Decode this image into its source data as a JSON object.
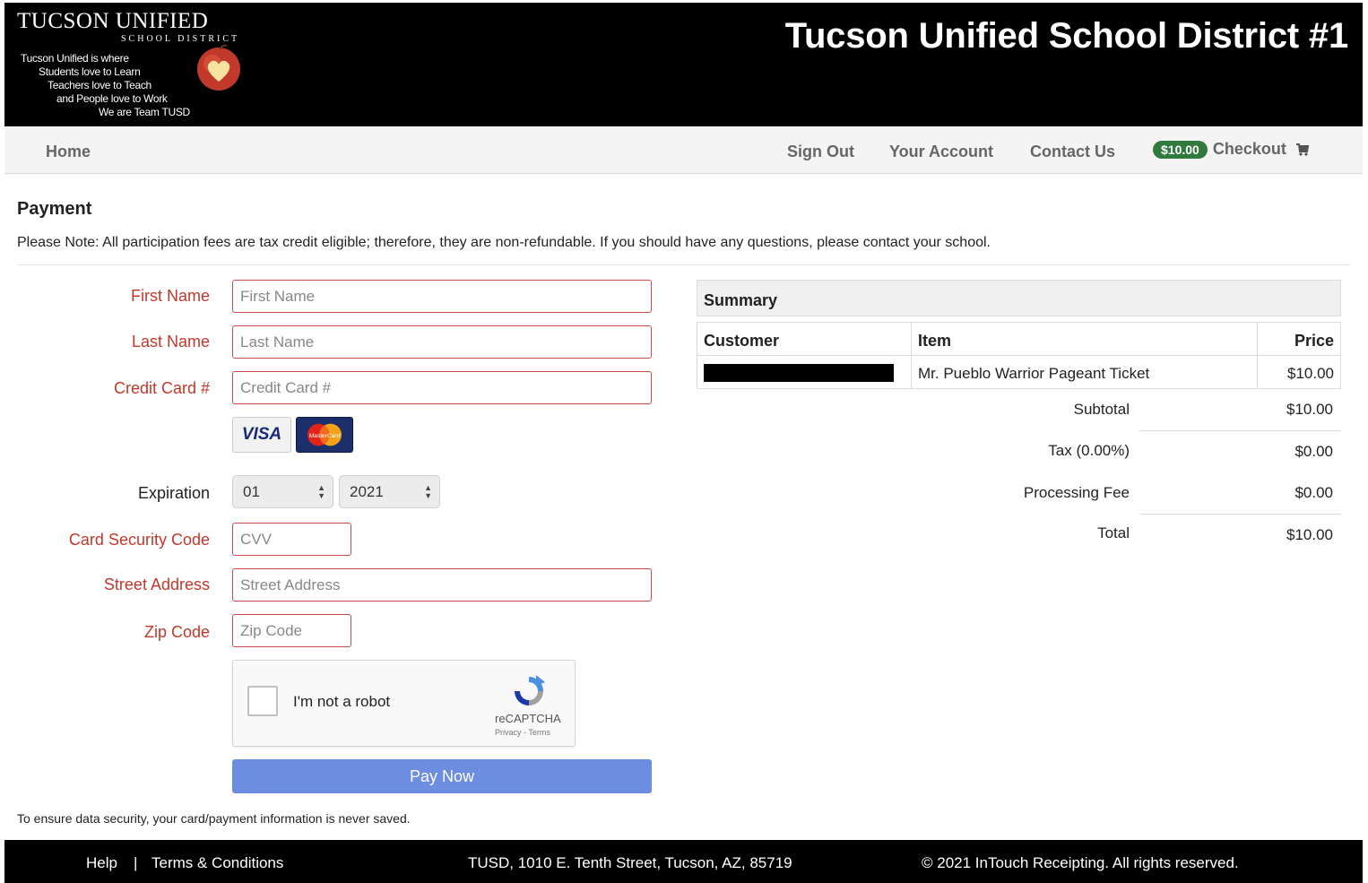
{
  "header": {
    "logo": {
      "title": "TUCSON UNIFIED",
      "subtitle": "SCHOOL DISTRICT",
      "tagline": [
        "Tucson Unified is where",
        "Students love to Learn",
        "Teachers love to Teach",
        "and People love to Work",
        "We are Team TUSD"
      ]
    },
    "title": "Tucson Unified School District #1"
  },
  "nav": {
    "home": "Home",
    "sign_out": "Sign Out",
    "your_account": "Your Account",
    "contact_us": "Contact Us",
    "cart_total": "$10.00",
    "checkout": "Checkout",
    "cart_icon": "shopping-cart-icon"
  },
  "page": {
    "title": "Payment",
    "note": "Please Note:  All participation fees are tax credit eligible; therefore, they are non-refundable.  If you should have any questions, please contact your school."
  },
  "form": {
    "first_name": {
      "label": "First Name",
      "placeholder": "First Name",
      "value": ""
    },
    "last_name": {
      "label": "Last Name",
      "placeholder": "Last Name",
      "value": ""
    },
    "credit_card": {
      "label": "Credit Card #",
      "placeholder": "Credit Card #",
      "value": ""
    },
    "cards": [
      "VISA",
      "MasterCard"
    ],
    "expiration": {
      "label": "Expiration",
      "month": "01",
      "year": "2021"
    },
    "cvv": {
      "label": "Card Security Code",
      "placeholder": "CVV",
      "value": ""
    },
    "street": {
      "label": "Street Address",
      "placeholder": "Street Address",
      "value": ""
    },
    "zip": {
      "label": "Zip Code",
      "placeholder": "Zip Code",
      "value": ""
    },
    "captcha": {
      "text": "I'm not a robot",
      "brand": "reCAPTCHA",
      "terms": "Privacy - Terms"
    },
    "pay_button": "Pay Now",
    "security_note": "To ensure data security, your card/payment information is never saved."
  },
  "summary": {
    "heading": "Summary",
    "columns": [
      "Customer",
      "Item",
      "Price"
    ],
    "rows": [
      {
        "customer": "",
        "item": "Mr. Pueblo Warrior Pageant Ticket",
        "price": "$10.00"
      }
    ],
    "subtotal_label": "Subtotal",
    "subtotal": "$10.00",
    "tax_label": "Tax (0.00%)",
    "tax": "$0.00",
    "fee_label": "Processing Fee",
    "fee": "$0.00",
    "total_label": "Total",
    "total": "$10.00"
  },
  "footer": {
    "help": "Help",
    "separator": "|",
    "terms": "Terms & Conditions",
    "address": "TUSD, 1010 E. Tenth Street, Tucson, AZ, 85719",
    "copyright": "© 2021 InTouch Receipting. All rights reserved."
  },
  "colors": {
    "header_bg": "#000000",
    "label_red": "#c0392b",
    "field_border": "#c94a4a",
    "badge_green": "#2f7a3c",
    "pay_button": "#6d8de0"
  }
}
